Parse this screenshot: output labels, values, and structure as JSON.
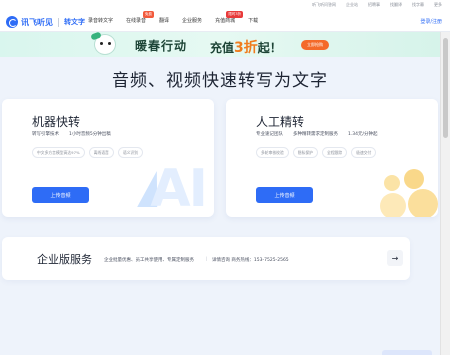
{
  "util_bar": {
    "links": [
      "听飞听问答网",
      "企业站",
      "招聘事",
      "找翻译",
      "找字幕",
      "更多"
    ]
  },
  "nav": {
    "logo_text": "讯飞听见",
    "logo_sub": "转文字",
    "items": [
      {
        "label": "录音转文字"
      },
      {
        "label": "在线录音",
        "badge": "免费"
      },
      {
        "label": "翻译"
      },
      {
        "label": "企业服务"
      },
      {
        "label": "充值商城",
        "badge": "限时3折"
      },
      {
        "label": "下载"
      }
    ],
    "login": "登录/注册"
  },
  "promo": {
    "title": "暖春行动",
    "offer_prefix": "充值",
    "offer_highlight": "3折",
    "offer_suffix": "起！",
    "cta": "立即抢购"
  },
  "hero": {
    "title": "音频、视频快速转写为文字"
  },
  "machine_card": {
    "title": "机器快转",
    "features": [
      "转写引擎技术",
      "1小时音频5分钟出稿"
    ],
    "tags": [
      "中文多方言模型高达97%",
      "离线语音",
      "语义识别"
    ],
    "upload": "上传音频",
    "watermark": "AI"
  },
  "human_card": {
    "title": "人工精转",
    "features": [
      "专业速记团队",
      "多种精转需求定制服务",
      "1.34元/分钟起"
    ],
    "tags": [
      "多轮审核校验",
      "隐私保护",
      "全程跟踪",
      "极速交付"
    ],
    "upload": "上传音频"
  },
  "enterprise": {
    "title": "企业版服务",
    "desc": "企业批量优惠、员工共享使用、专属定制服务",
    "separator": "|",
    "contact": "详情咨询 商务热线：153-7525-2565",
    "arrow": "→"
  },
  "colors": {
    "accent": "#2e6cf6",
    "promo_bg": "#d9f6ee",
    "cta": "#f46a2a"
  }
}
